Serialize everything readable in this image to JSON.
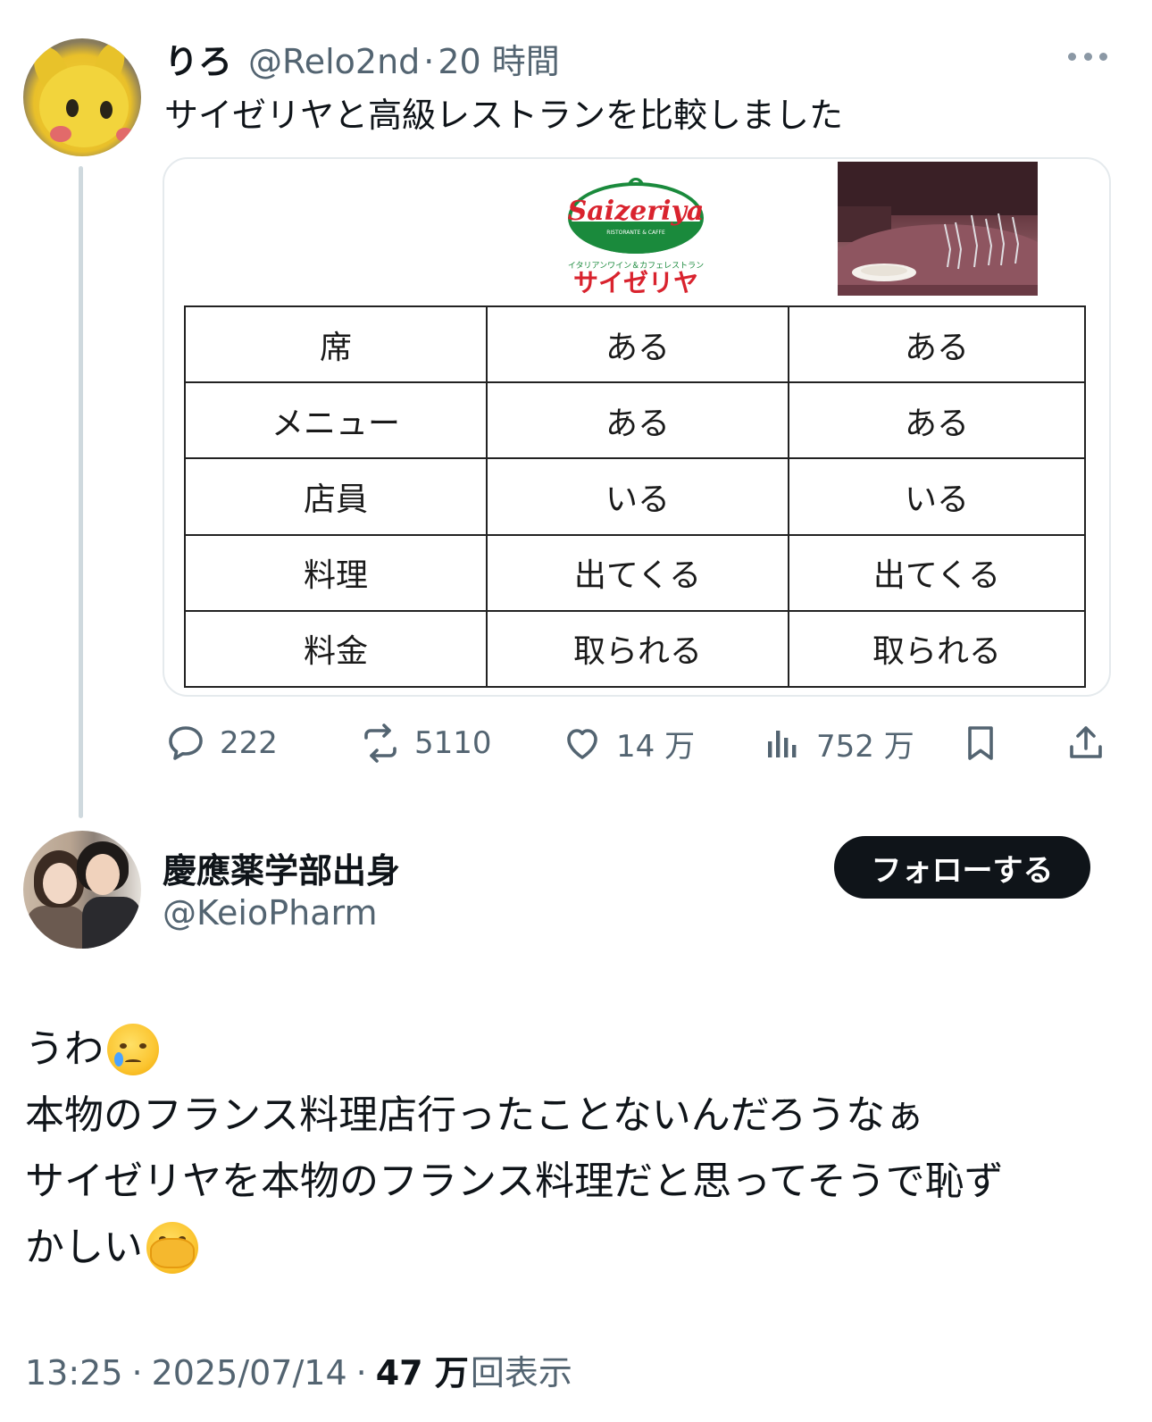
{
  "parent_tweet": {
    "display_name": "りろ",
    "handle": "@Relo2nd",
    "separator": "·",
    "time": "20 時間",
    "text": "サイゼリヤと高級レストランを比較しました",
    "media": {
      "logo_en": "Saizeriya",
      "logo_sub": "RISTORANTE & CAFFE",
      "logo_tagline": "イタリアンワイン＆カフェレストラン",
      "logo_jp": "サイゼリヤ",
      "table": {
        "rows": [
          [
            "席",
            "ある",
            "ある"
          ],
          [
            "メニュー",
            "ある",
            "ある"
          ],
          [
            "店員",
            "いる",
            "いる"
          ],
          [
            "料理",
            "出てくる",
            "出てくる"
          ],
          [
            "料金",
            "取られる",
            "取られる"
          ]
        ]
      }
    },
    "actions": {
      "reply_count": "222",
      "repost_count": "5110",
      "like_count": "14 万",
      "view_count": "752 万"
    }
  },
  "reply_tweet": {
    "display_name": "慶應薬学部出身",
    "handle": "@KeioPharm",
    "follow_label": "フォローする",
    "lines": [
      "うわ",
      "本物のフランス料理店行ったことないんだろうなぁ",
      "サイゼリヤを本物のフランス料理だと思ってそうで恥ず",
      "かしい"
    ],
    "emojis": [
      "crying-face",
      "face-with-open-eyes-and-hand-over-mouth"
    ],
    "meta": {
      "time": "13:25",
      "date": "2025/07/14",
      "separator": "·",
      "views": "47 万",
      "views_label": "回表示"
    }
  },
  "colors": {
    "text": "#0f1419",
    "secondary": "#536471",
    "border": "#e5eaed",
    "thread_line": "#cfd9de",
    "saizeriya_green": "#1a8a3c",
    "saizeriya_red": "#d9232e"
  }
}
